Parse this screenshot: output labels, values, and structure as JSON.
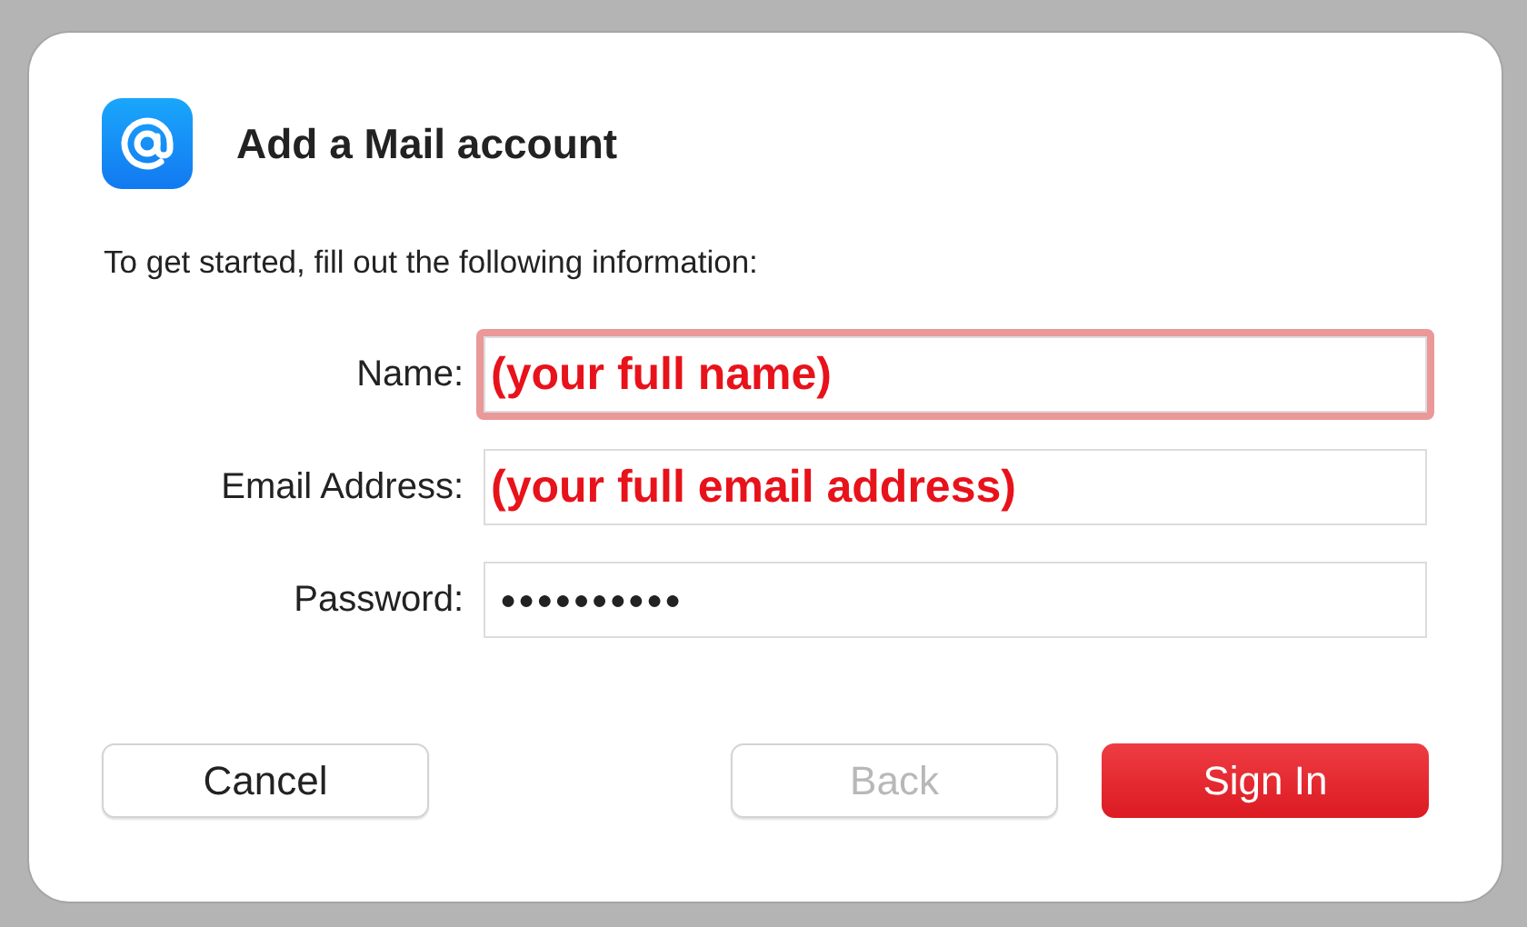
{
  "dialog": {
    "title": "Add a Mail account",
    "instruction": "To get started, fill out the following information:",
    "fields": [
      {
        "label": "Name:",
        "value": "(your full name)",
        "kind": "text",
        "focused": true
      },
      {
        "label": "Email Address:",
        "value": "(your full email address)",
        "kind": "text",
        "focused": false
      },
      {
        "label": "Password:",
        "value": "●●●●●●●●●●",
        "kind": "password",
        "focused": false
      }
    ],
    "buttons": [
      {
        "label": "Cancel",
        "kind": "secondary",
        "disabled": false
      },
      {
        "label": "Back",
        "kind": "secondary",
        "disabled": true
      },
      {
        "label": "Sign In",
        "kind": "primary",
        "disabled": false
      }
    ]
  }
}
